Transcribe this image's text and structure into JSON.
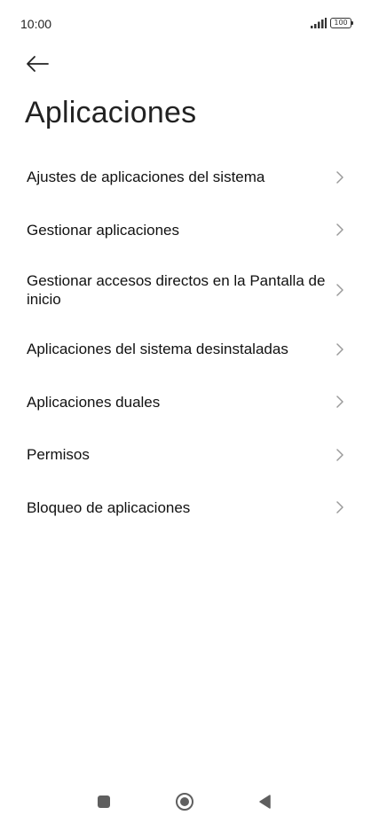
{
  "status_bar": {
    "time": "10:00",
    "battery": "100",
    "icons": [
      "signal-icon",
      "battery-icon"
    ]
  },
  "header": {
    "back_icon": "arrow-left-icon",
    "title": "Aplicaciones"
  },
  "menu": {
    "items": [
      {
        "label": "Ajustes de aplicaciones del sistema"
      },
      {
        "label": "Gestionar aplicaciones"
      },
      {
        "label": "Gestionar accesos directos en la Pantalla de inicio"
      },
      {
        "label": "Aplicaciones del sistema desinstaladas"
      },
      {
        "label": "Aplicaciones duales"
      },
      {
        "label": "Permisos"
      },
      {
        "label": "Bloqueo de aplicaciones"
      }
    ],
    "chevron_icon": "chevron-right-icon"
  },
  "nav_bar": {
    "icons": [
      "recents-square-icon",
      "home-circle-icon",
      "back-triangle-icon"
    ]
  },
  "colors": {
    "background": "#ffffff",
    "text": "#111111",
    "chevron": "#9a9a9a",
    "nav_icons": "#5f5f5f"
  }
}
